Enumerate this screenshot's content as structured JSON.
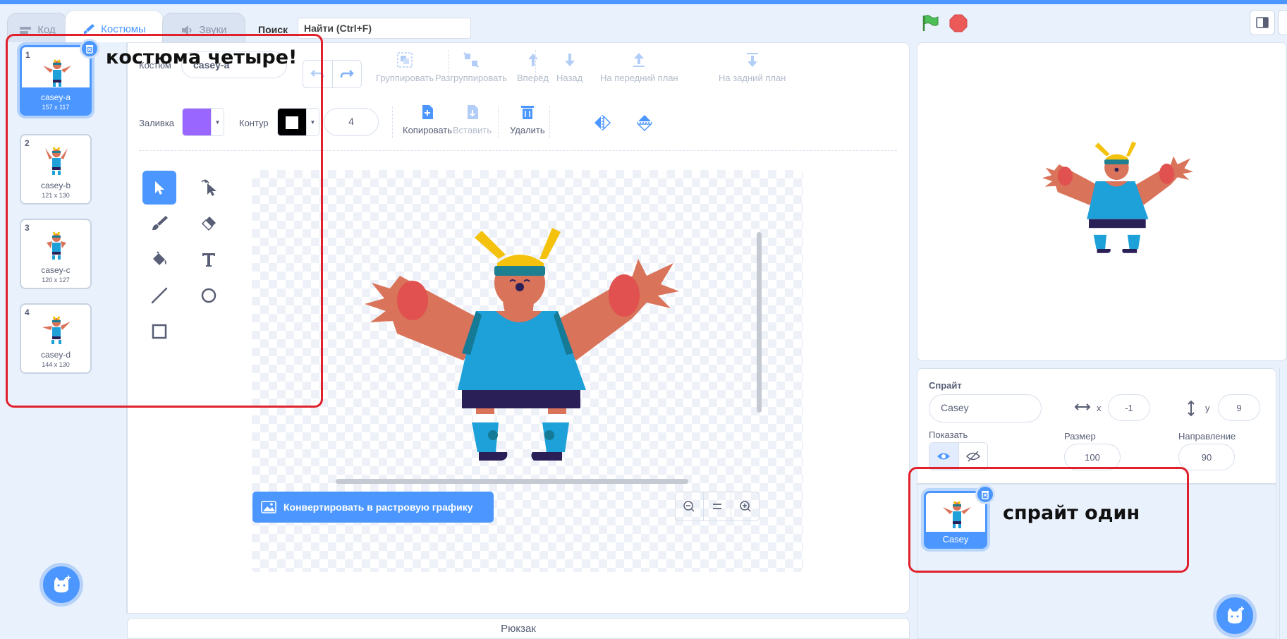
{
  "tabs": [
    {
      "label": "Код",
      "icon": "code-icon"
    },
    {
      "label": "Костюмы",
      "icon": "brush-icon"
    },
    {
      "label": "Звуки",
      "icon": "speaker-icon"
    }
  ],
  "search": {
    "label": "Поиск",
    "value": "Найти (Ctrl+F)"
  },
  "costumes": [
    {
      "num": "1",
      "name": "casey-a",
      "size": "157 x 117"
    },
    {
      "num": "2",
      "name": "casey-b",
      "size": "121 x 130"
    },
    {
      "num": "3",
      "name": "casey-c",
      "size": "120 x 127"
    },
    {
      "num": "4",
      "name": "casey-d",
      "size": "144 x 130"
    }
  ],
  "editor": {
    "costume_label": "Костюм",
    "costume_name": "casey-a",
    "group": "Группировать",
    "ungroup": "Разгруппировать",
    "forward": "Вперёд",
    "backward": "Назад",
    "front": "На передний план",
    "back": "На задний план",
    "fill_label": "Заливка",
    "fill_color": "#9966ff",
    "outline_label": "Контур",
    "outline_color": "#000000",
    "outline_width": "4",
    "copy": "Копировать",
    "paste": "Вставить",
    "delete": "Удалить",
    "convert": "Конвертировать в растровую графику"
  },
  "backpack": "Рюкзак",
  "sprite": {
    "label": "Спрайт",
    "name": "Casey",
    "x_label": "x",
    "x": "-1",
    "y_label": "y",
    "y": "9",
    "show_label": "Показать",
    "size_label": "Размер",
    "size": "100",
    "direction_label": "Направление",
    "direction": "90",
    "tile_name": "Casey"
  },
  "annotations": {
    "costumes_note": "костюма четыре!",
    "sprite_note": "спрайт один"
  },
  "colors": {
    "accent": "#4c97ff",
    "annotation": "#e0202a"
  }
}
